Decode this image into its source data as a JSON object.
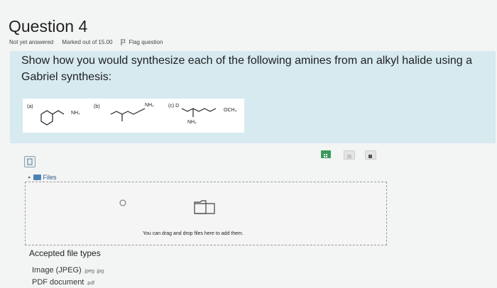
{
  "question": {
    "title": "Question 4",
    "status": "Not yet answered",
    "marks": "Marked out of 15.00",
    "flag_label": "Flag question",
    "text": "Show how you would synthesize each of the following amines from an alkyl halide using a Gabriel synthesis:"
  },
  "structures": {
    "a_label": "(a)",
    "a_group": "NH₂",
    "b_label": "(b)",
    "b_group": "NH₂",
    "c_label": "(c) D",
    "c_group_top": "OCH₃",
    "c_group_bottom": "NH₂"
  },
  "upload": {
    "files_label": "Files",
    "drop_text": "You can drag and drop files here to add them.",
    "accepted_title": "Accepted file types",
    "types": [
      {
        "name": "Image (JPEG)",
        "ext": ".jpeg .jpg"
      },
      {
        "name": "PDF document",
        "ext": ".pdf"
      }
    ]
  },
  "colors": {
    "question_bg": "#d6eaf0",
    "toolbar_active": "#3a9a5a",
    "link": "#2b5d8a"
  }
}
